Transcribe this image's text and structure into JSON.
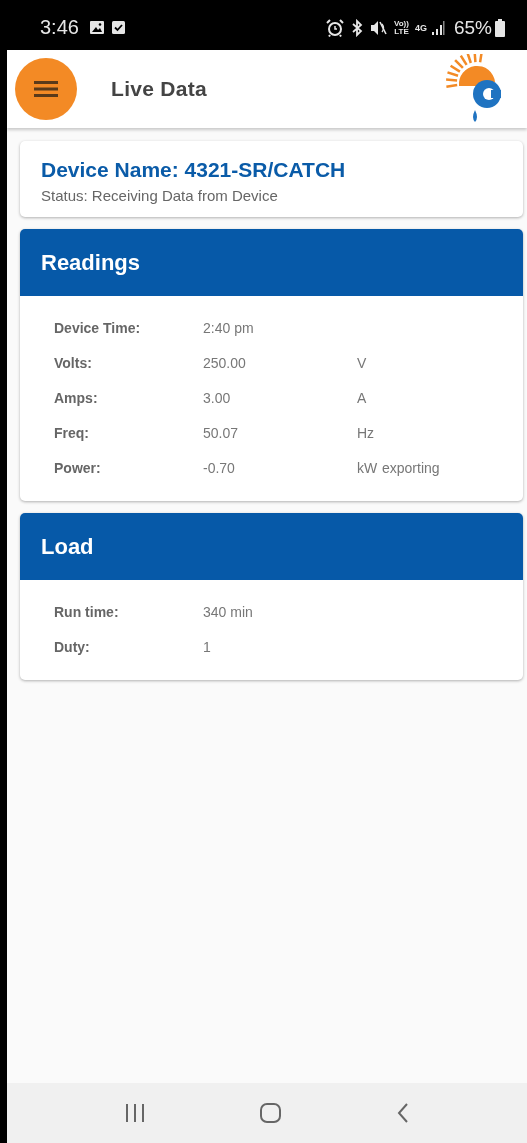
{
  "status_bar": {
    "time": "3:46",
    "volte": [
      "Vo))",
      "LTE"
    ],
    "network": "4G",
    "battery": "65%"
  },
  "app_bar": {
    "title": "Live Data"
  },
  "device": {
    "name": "Device Name: 4321-SR/CATCH",
    "status": "Status: Receiving Data from Device"
  },
  "sections": [
    {
      "title": "Readings",
      "rows": [
        {
          "label": "Device Time:",
          "value": "2:40 pm"
        },
        {
          "label": "Volts:",
          "value": "250.00",
          "unit": "V"
        },
        {
          "label": "Amps:",
          "value": "3.00",
          "unit": "A"
        },
        {
          "label": "Freq:",
          "value": "50.07",
          "unit": "Hz"
        },
        {
          "label": "Power:",
          "value": "-0.70",
          "unit": "kW",
          "note": "exporting"
        }
      ]
    },
    {
      "title": "Load",
      "rows": [
        {
          "label": "Run time:",
          "value": "340 min"
        },
        {
          "label": "Duty:",
          "value": "1"
        }
      ]
    }
  ]
}
